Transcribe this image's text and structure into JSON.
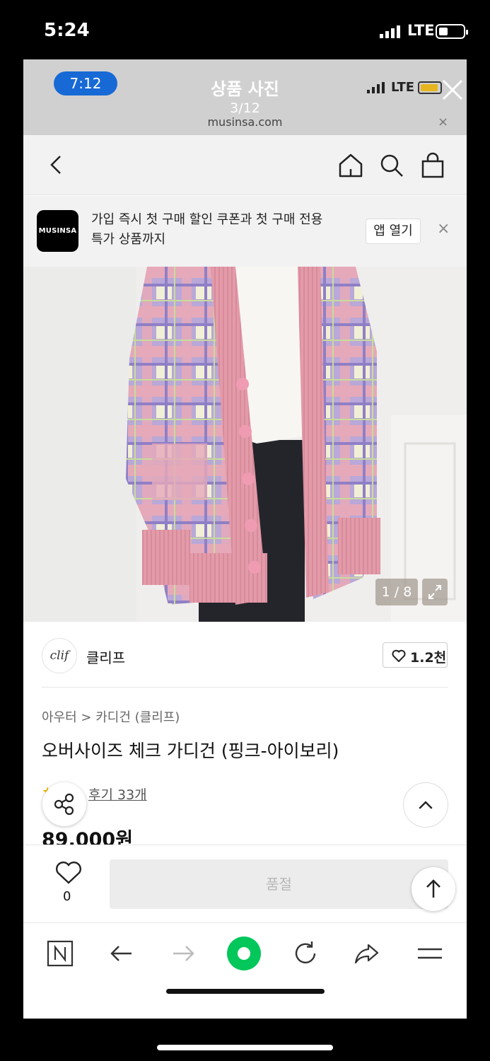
{
  "status_bar": {
    "time": "5:24",
    "network": "LTE"
  },
  "viewer": {
    "time": "7:12",
    "network": "LTE",
    "title": "상품 사진",
    "counter": "3/12",
    "url": "musinsa.com",
    "url_close": "×"
  },
  "app_banner": {
    "logo_text": "MUSINSA",
    "line1": "가입 즉시 첫 구매 할인 쿠폰과 첫 구매 전용",
    "line2": "특가 상품까지",
    "open_label": "앱 열기",
    "close": "×"
  },
  "product_image": {
    "counter": "1 / 8"
  },
  "brand": {
    "logo_text": "clif",
    "name": "클리프",
    "likes": "1.2천"
  },
  "product": {
    "breadcrumb": "아우터 > 카디건 (클리프)",
    "title": "오버사이즈 체크 가디건 (핑크-아이보리)",
    "review_link": "후기 33개",
    "price": "89,000원"
  },
  "purchase": {
    "wish_count": "0",
    "soldout_label": "품절"
  },
  "colors": {
    "accent_green": "#03c75a",
    "time_pill": "#1769d6",
    "cardigan_pink": "#e8a3b0",
    "plaid_purple": "#a89ad6"
  }
}
